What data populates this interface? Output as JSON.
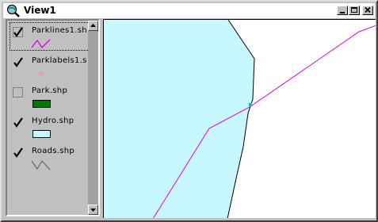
{
  "window": {
    "title": "View1"
  },
  "colors": {
    "parklines": "#e000e0",
    "parklabels": "#ff9999",
    "park_fill": "#007700",
    "hydro_fill": "#c8f8ff",
    "roads": "#606060",
    "selection_marker": "#00c0c0"
  },
  "toc": {
    "layers": [
      {
        "label": "Parklines1.sh",
        "checked": true,
        "symbol": "line-icon"
      },
      {
        "label": "Parklabels1.s",
        "checked": true,
        "symbol": "point-icon"
      },
      {
        "label": "Park.shp",
        "checked": false,
        "symbol": "polygon-icon"
      },
      {
        "label": "Hydro.shp",
        "checked": true,
        "symbol": "polygon-icon"
      },
      {
        "label": "Roads.shp",
        "checked": true,
        "symbol": "line-icon"
      }
    ]
  }
}
